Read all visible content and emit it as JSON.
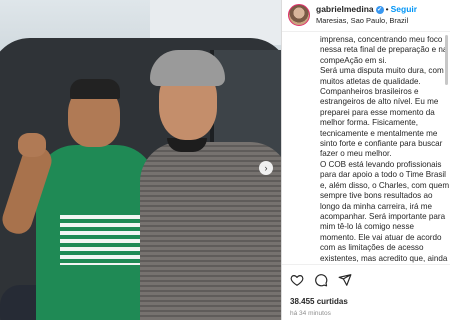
{
  "post": {
    "username": "gabrielmedina",
    "verified_badge": "✓",
    "separator": "•",
    "follow_label": "Seguir",
    "location": "Maresias, Sao Paulo, Brazil",
    "caption": "imprensa, concentrando meu foco nessa reta final de preparação e na compeAção em si.\nSerá uma disputa muito dura, com muitos atletas de qualidade. Companheiros brasileiros e estrangeiros de alto nível. Eu me preparei para esse momento da melhor forma. Fisicamente, tecnicamente e mentalmente me sinto forte e confiante para buscar fazer o meu melhor.\nO COB está levando profissionais para dar apoio a todo o Time Brasil e, além disso, o Charles, com quem sempre tive bons resultados ao longo da minha carreira, irá me acompanhar. Será importante para mim tê-lo lá comigo nesse momento. Ele vai atuar de acordo com as limitações de acesso existentes, mas acredito que, ainda assim, ele poderá contribuir em",
    "likes": "38.455 curtidas",
    "time_ago": "há 34 minutos"
  },
  "carousel": {
    "next_icon": "chevron-right-icon"
  },
  "icons": {
    "like": "heart-icon",
    "comment": "comment-icon",
    "share": "send-icon"
  },
  "colors": {
    "accent": "#0095f6",
    "verified": "#3897f0",
    "story_ring": "#e1306c"
  }
}
